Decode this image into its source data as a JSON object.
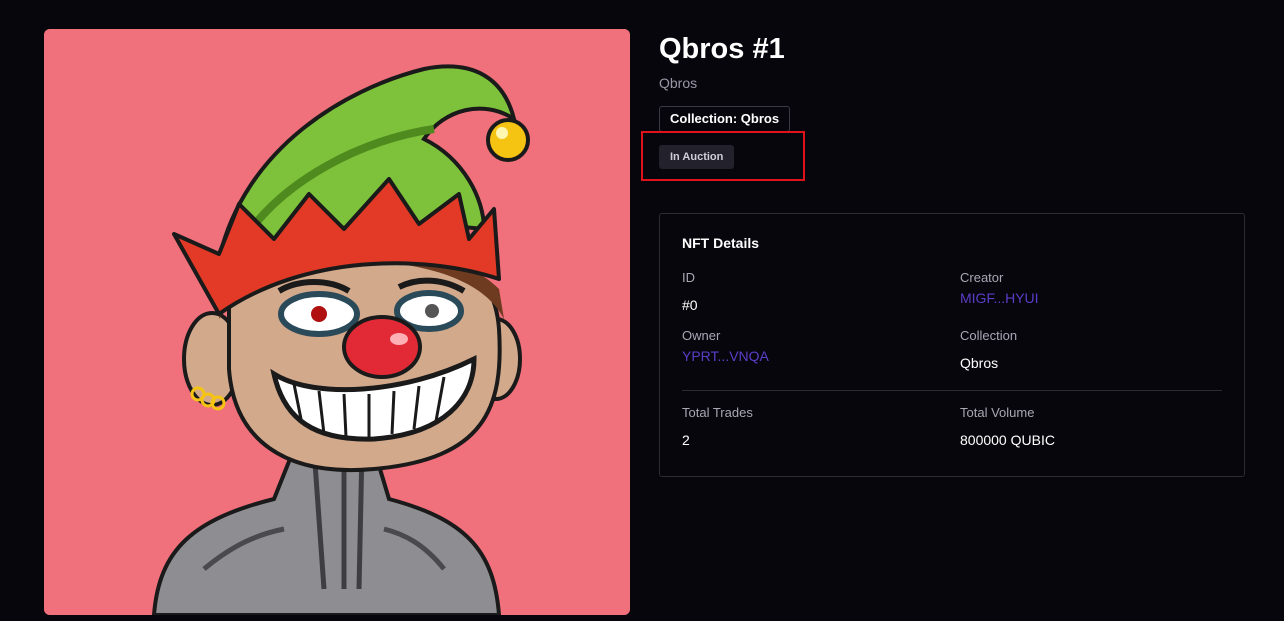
{
  "nft": {
    "title": "Qbros #1",
    "subtitle": "Qbros",
    "collection_button": "Collection: Qbros",
    "status_badge": "In Auction",
    "image_palette": {
      "background": "#f0707b",
      "hat_green": "#7dc23a",
      "hat_band": "#e23a26",
      "bell": "#f5c312",
      "skin": "#d3a98c",
      "nose": "#e12a36",
      "body": "#8c8c8f"
    }
  },
  "details": {
    "heading": "NFT Details",
    "id_label": "ID",
    "id_value": "#0",
    "creator_label": "Creator",
    "creator_value": "MIGF...HYUI",
    "owner_label": "Owner",
    "owner_value": "YPRT...VNQA",
    "collection_label": "Collection",
    "collection_value": "Qbros",
    "trades_label": "Total Trades",
    "trades_value": "2",
    "volume_label": "Total Volume",
    "volume_value": "800000 QUBIC"
  },
  "colors": {
    "page_bg": "#07060d",
    "link": "#5b3ec8",
    "highlight": "#e0121c"
  }
}
